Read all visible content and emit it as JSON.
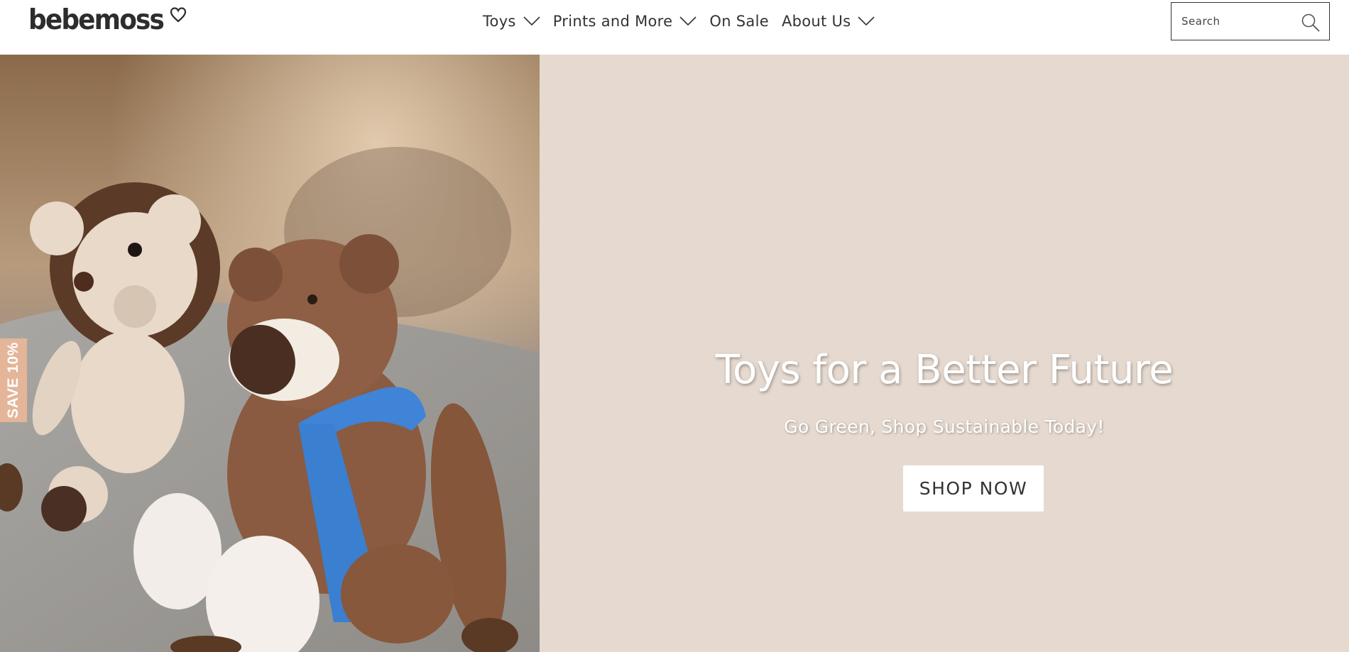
{
  "brand": {
    "name": "bebemoss"
  },
  "nav": {
    "items": [
      {
        "label": "Toys",
        "has_dropdown": true
      },
      {
        "label": "Prints and More",
        "has_dropdown": true
      },
      {
        "label": "On Sale",
        "has_dropdown": false
      },
      {
        "label": "About Us",
        "has_dropdown": true
      }
    ]
  },
  "search": {
    "placeholder": "Search",
    "icon": "search-icon"
  },
  "hero": {
    "title": "Toys for a Better Future",
    "subtitle": "Go Green, Shop Sustainable Today!",
    "cta_label": "SHOP NOW",
    "panel_color": "#e6dad0",
    "image_description_icon": "crochet-toys-photo"
  },
  "promo": {
    "save_label": "SAVE 10%",
    "color": "#e4b598"
  }
}
